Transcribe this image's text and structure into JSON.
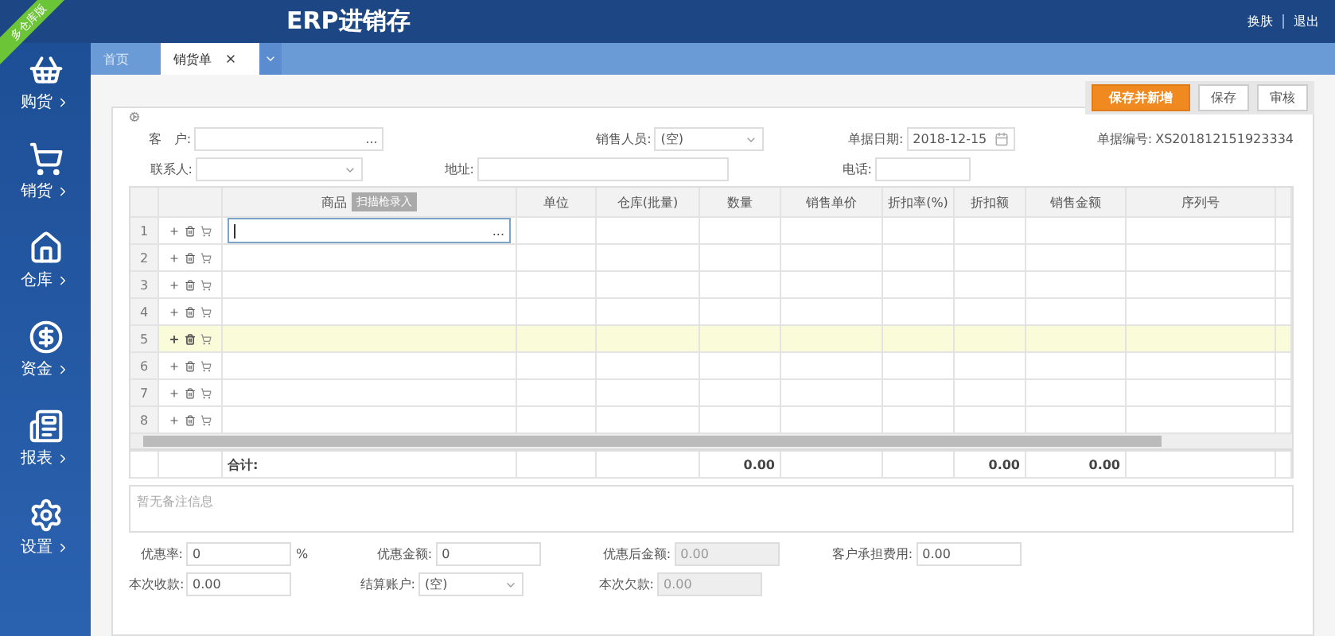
{
  "app": {
    "title": "ERP进销存",
    "edition_ribbon": "多仓库版",
    "header_links": [
      "换肤",
      "退出"
    ]
  },
  "sidebar": {
    "items": [
      {
        "label": "购货"
      },
      {
        "label": "销货"
      },
      {
        "label": "仓库"
      },
      {
        "label": "资金"
      },
      {
        "label": "报表"
      },
      {
        "label": "设置"
      }
    ]
  },
  "tabs": [
    {
      "label": "首页",
      "selected": false,
      "closable": false
    },
    {
      "label": "销货单",
      "selected": true,
      "closable": true
    }
  ],
  "toolbar": {
    "buttons": [
      {
        "label": "保存并新增",
        "kind": "primary"
      },
      {
        "label": "保存",
        "kind": "default"
      },
      {
        "label": "审核",
        "kind": "default"
      }
    ]
  },
  "form": {
    "rows": [
      [
        {
          "label": "客　户:",
          "kind": "picker",
          "picker": "..."
        },
        {
          "label": "销售人员:",
          "kind": "select",
          "value": "(空)"
        },
        {
          "label": "单据日期:",
          "kind": "date",
          "value": "2018-12-15"
        },
        {
          "label": "单据编号:",
          "kind": "readonly",
          "value": "XS201812151923334"
        }
      ],
      [
        {
          "label": "联系人:",
          "kind": "select"
        },
        {
          "label": "地址:",
          "kind": "text"
        },
        {
          "label": "电话:",
          "kind": "text"
        }
      ]
    ]
  },
  "table": {
    "columns": [
      {
        "label": "商品",
        "badge": "扫描枪录入"
      },
      {
        "label": "单位"
      },
      {
        "label": "仓库(批量)"
      },
      {
        "label": "数量",
        "total": "0.00"
      },
      {
        "label": "销售单价"
      },
      {
        "label": "折扣率(%)"
      },
      {
        "label": "折扣额",
        "total": "0.00"
      },
      {
        "label": "销售金额",
        "total": "0.00"
      },
      {
        "label": "序列号"
      }
    ],
    "rows": [
      {
        "no": "1",
        "selected": false,
        "editing": true
      },
      {
        "no": "2",
        "selected": false,
        "editing": false
      },
      {
        "no": "3",
        "selected": false,
        "editing": false
      },
      {
        "no": "4",
        "selected": false,
        "editing": false
      },
      {
        "no": "5",
        "selected": true,
        "editing": false
      },
      {
        "no": "6",
        "selected": false,
        "editing": false
      },
      {
        "no": "7",
        "selected": false,
        "editing": false
      },
      {
        "no": "8",
        "selected": false,
        "editing": false
      }
    ],
    "editor_picker": "...",
    "total_label": "合计:"
  },
  "notes": {
    "placeholder": "暂无备注信息"
  },
  "summary": {
    "rows": [
      [
        {
          "label": "优惠率:",
          "kind": "text",
          "value": "0",
          "unit": "%"
        },
        {
          "label": "优惠金额:",
          "kind": "text",
          "value": "0"
        },
        {
          "label": "优惠后金额:",
          "kind": "readonly",
          "value": "0.00"
        },
        {
          "label": "客户承担费用:",
          "kind": "text",
          "value": "0.00"
        }
      ],
      [
        {
          "label": "本次收款:",
          "kind": "text",
          "value": "0.00"
        },
        {
          "label": "结算账户:",
          "kind": "select",
          "value": "(空)"
        },
        {
          "label": "本次欠款:",
          "kind": "readonly",
          "value": "0.00"
        }
      ]
    ]
  }
}
